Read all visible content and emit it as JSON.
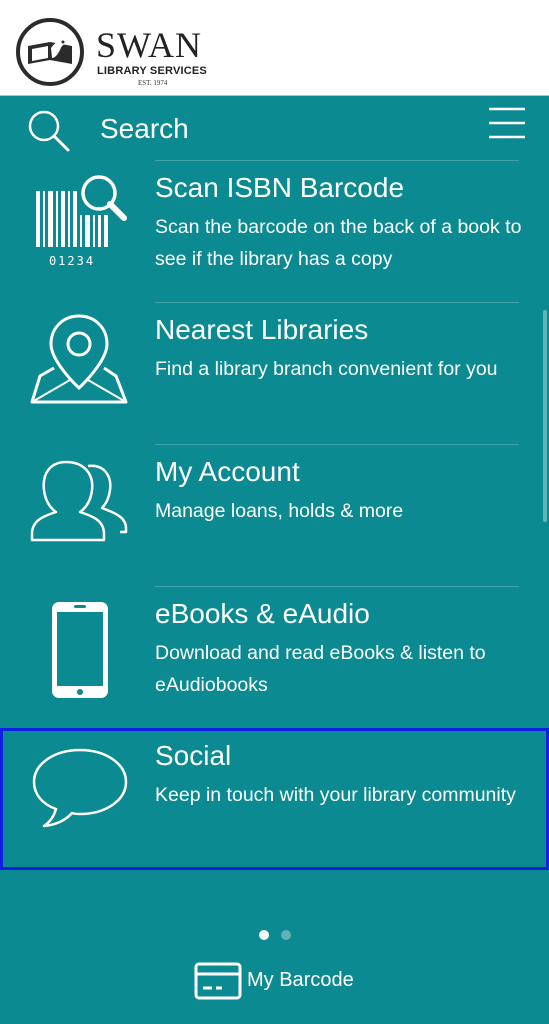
{
  "header": {
    "logo_name": "SWAN",
    "logo_subtitle": "LIBRARY SERVICES",
    "logo_est": "EST. 1974"
  },
  "search": {
    "label": "Search"
  },
  "menu": [
    {
      "title": "Scan ISBN Barcode",
      "description": "Scan the barcode on the back of a book to see if the library has a copy",
      "icon": "barcode-scan-icon",
      "barcode_digits": "01234"
    },
    {
      "title": "Nearest Libraries",
      "description": "Find a library branch convenient for you",
      "icon": "map-pin-icon"
    },
    {
      "title": "My Account",
      "description": "Manage loans, holds & more",
      "icon": "users-icon"
    },
    {
      "title": "eBooks & eAudio",
      "description": "Download and read eBooks & listen to eAudiobooks",
      "icon": "smartphone-icon"
    },
    {
      "title": "Social",
      "description": "Keep in touch with your library community",
      "icon": "speech-bubble-icon"
    }
  ],
  "pagination": {
    "pages": 2,
    "current": 1
  },
  "footer": {
    "barcode_label": "My Barcode"
  },
  "colors": {
    "teal_background": "#0b8a91",
    "highlight_outline": "#1020e0",
    "text": "#ffffff"
  }
}
